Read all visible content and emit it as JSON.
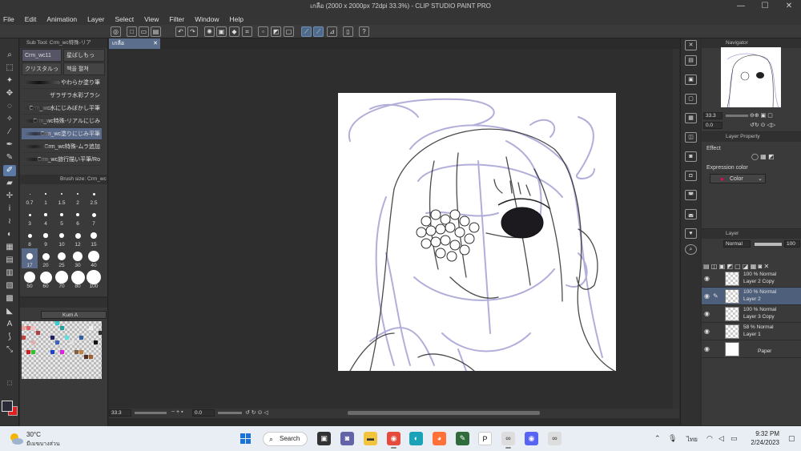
{
  "window": {
    "title": "เกลือ (2000 x 2000px 72dpi 33.3%) - CLIP STUDIO PAINT PRO",
    "controls": [
      "—",
      "☐",
      "✕"
    ]
  },
  "menu": [
    "File",
    "Edit",
    "Animation",
    "Layer",
    "Select",
    "View",
    "Filter",
    "Window",
    "Help"
  ],
  "subtool": {
    "header": "Sub Tool: Crm_wc特殊-リア",
    "tabs": [
      "Crm_wc11",
      "星ばしもっ",
      "クリスタルっ",
      "책을 펼쳐"
    ],
    "brushes": [
      "やわらか塗り筆",
      "ザラザラ水彩ブラシ",
      "Crm_wc水にじみぼかし平筆",
      "Crm_wc特殊-リアルにじみ",
      "Crm_wc塗りにじみ平筆",
      "Crm_wc特殊-ムラ追加",
      "Crm_wc旅行描い平筆/Ro"
    ],
    "active_brush_index": 4
  },
  "brush_size": {
    "header": "Brush size: Crm_wc",
    "sizes": [
      "0.7",
      "1",
      "1.5",
      "2",
      "2.5",
      "3",
      "4",
      "5",
      "6",
      "7",
      "8",
      "9",
      "10",
      "12",
      "15",
      "17",
      "20",
      "25",
      "30",
      "40",
      "50",
      "60",
      "70",
      "80",
      "100"
    ],
    "active": "17"
  },
  "color_set": {
    "name": "Kum A"
  },
  "canvas": {
    "tab_label": "เกลือ",
    "zoom": "33.3",
    "rotation": "0.0"
  },
  "navigator": {
    "header": "Navigator",
    "zoom": "33.3",
    "rotation": "0.0"
  },
  "layer_property": {
    "header": "Layer Property",
    "effect_label": "Effect",
    "expression_label": "Expression color",
    "expression_value": "Color"
  },
  "layer_panel": {
    "header": "Layer",
    "blend_mode": "Normal",
    "opacity": "100",
    "layers": [
      {
        "mode": "100 % Normal",
        "name": "Layer 2 Copy",
        "active": false
      },
      {
        "mode": "100 % Normal",
        "name": "Layer 2",
        "active": true
      },
      {
        "mode": "100 % Normal",
        "name": "Layer 3 Copy",
        "active": false
      },
      {
        "mode": "58 % Normal",
        "name": "Layer 1",
        "active": false
      },
      {
        "mode": "",
        "name": "Paper",
        "active": false
      }
    ]
  },
  "taskbar": {
    "weather_temp": "30°C",
    "weather_desc": "มีเมฆบางส่วน",
    "search_label": "Search",
    "language": "ไทย",
    "time": "9:32 PM",
    "date": "2/24/2023"
  },
  "colors": {
    "accent": "#5a7aa5",
    "fg_color": "#2a2a38",
    "bg_color": "#e31e1e",
    "sketch_lavender": "#a9a6d6",
    "lineart": "#2c2c2c"
  }
}
